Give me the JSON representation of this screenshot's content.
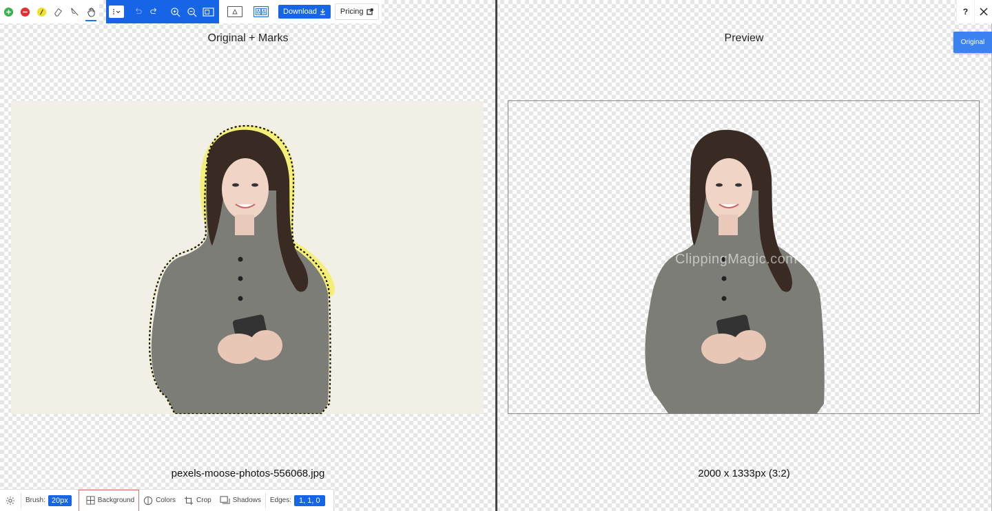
{
  "toolbar": {
    "download_label": "Download",
    "pricing_label": "Pricing"
  },
  "top_right": {
    "help_label": "?",
    "original_tab_label": "Original"
  },
  "left_pane": {
    "title": "Original + Marks",
    "filename": "pexels-moose-photos-556068.jpg"
  },
  "right_pane": {
    "title": "Preview",
    "dimensions": "2000 x 1333px (3:2)",
    "watermark": "ClippingMagic.com"
  },
  "bottom_bar": {
    "brush_label": "Brush:",
    "brush_value": "20px",
    "background_label": "Background",
    "colors_label": "Colors",
    "crop_label": "Crop",
    "shadows_label": "Shadows",
    "edges_label": "Edges:",
    "edges_value": "1, 1, 0"
  },
  "colors": {
    "accent": "#1565e6",
    "image_bg": "#f1efe6",
    "highlight_border": "#e07070"
  }
}
